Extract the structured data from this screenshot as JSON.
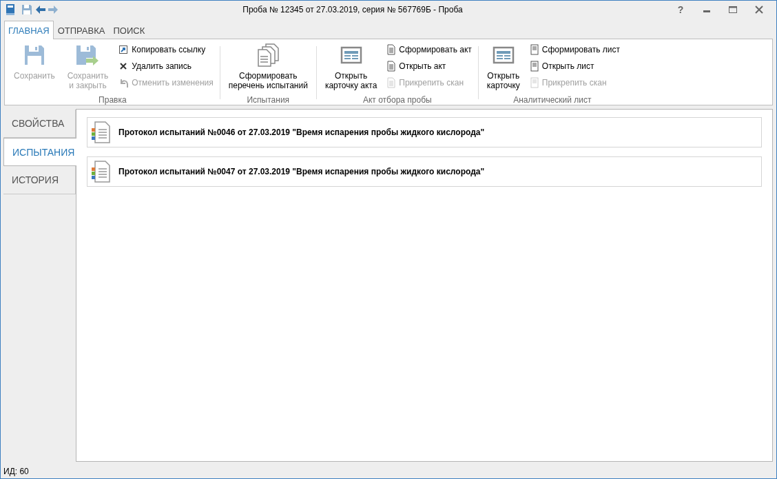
{
  "window": {
    "title": "Проба № 12345 от 27.03.2019, серия № 567769Б - Проба",
    "help": "?"
  },
  "ribbon": {
    "tabs": [
      {
        "label": "ГЛАВНАЯ",
        "selected": true
      },
      {
        "label": "ОТПРАВКА",
        "selected": false
      },
      {
        "label": "ПОИСК",
        "selected": false
      }
    ],
    "groups": [
      {
        "label": "Правка",
        "items": [
          {
            "kind": "large",
            "label": "Сохранить",
            "disabled": true
          },
          {
            "kind": "large",
            "label": "Сохранить\nи закрыть",
            "disabled": true
          },
          {
            "kind": "small",
            "label": "Копировать ссылку",
            "disabled": false
          },
          {
            "kind": "small",
            "label": "Удалить запись",
            "disabled": false
          },
          {
            "kind": "small",
            "label": "Отменить изменения",
            "disabled": true
          }
        ]
      },
      {
        "label": "Испытания",
        "items": [
          {
            "kind": "large",
            "label": "Сформировать\nперечень испытаний",
            "disabled": false
          }
        ]
      },
      {
        "label": "Акт отбора пробы",
        "items": [
          {
            "kind": "large",
            "label": "Открыть\nкарточку акта",
            "disabled": false
          },
          {
            "kind": "small",
            "label": "Сформировать акт",
            "disabled": false
          },
          {
            "kind": "small",
            "label": "Открыть акт",
            "disabled": false
          },
          {
            "kind": "small",
            "label": "Прикрепить скан",
            "disabled": true
          }
        ]
      },
      {
        "label": "Аналитический лист",
        "items": [
          {
            "kind": "large",
            "label": "Открыть\nкарточку",
            "disabled": false
          },
          {
            "kind": "small",
            "label": "Сформировать лист",
            "disabled": false
          },
          {
            "kind": "small",
            "label": "Открыть лист",
            "disabled": false
          },
          {
            "kind": "small",
            "label": "Прикрепить скан",
            "disabled": true
          }
        ]
      }
    ]
  },
  "side_tabs": [
    {
      "label": "СВОЙСТВА",
      "selected": false
    },
    {
      "label": "ИСПЫТАНИЯ",
      "selected": true
    },
    {
      "label": "ИСТОРИЯ",
      "selected": false
    }
  ],
  "documents": [
    {
      "title": "Протокол испытаний №0046 от 27.03.2019 \"Время испарения пробы жидкого кислорода\""
    },
    {
      "title": "Протокол испытаний №0047 от 27.03.2019 \"Время испарения пробы жидкого кислорода\""
    }
  ],
  "status_bar": {
    "text": "ИД: 60"
  }
}
